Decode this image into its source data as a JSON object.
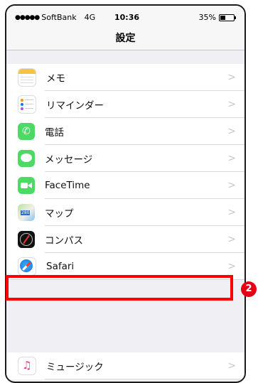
{
  "status_bar": {
    "carrier": "SoftBank",
    "network": "4G",
    "time": "10:36",
    "battery": "35%",
    "signal_dots": "●●●●●"
  },
  "nav": {
    "title": "設定"
  },
  "settings_items": [
    {
      "label": "メモ",
      "icon": "notes-icon"
    },
    {
      "label": "リマインダー",
      "icon": "reminders-icon"
    },
    {
      "label": "電話",
      "icon": "phone-icon"
    },
    {
      "label": "メッセージ",
      "icon": "messages-icon"
    },
    {
      "label": "FaceTime",
      "icon": "facetime-icon"
    },
    {
      "label": "マップ",
      "icon": "maps-icon"
    },
    {
      "label": "コンパス",
      "icon": "compass-icon"
    },
    {
      "label": "Safari",
      "icon": "safari-icon"
    }
  ],
  "music_item": {
    "label": "ミュージック",
    "icon": "music-icon"
  },
  "chevron": ">",
  "annotation": {
    "step_number": "2",
    "highlight_color": "#ff0000",
    "badge_color": "#e60012"
  }
}
